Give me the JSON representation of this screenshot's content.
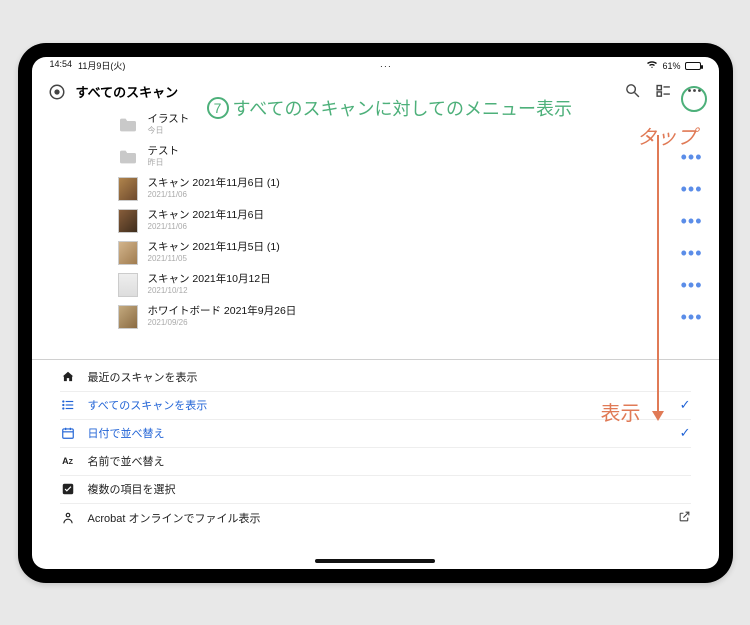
{
  "status": {
    "time": "14:54",
    "date": "11月9日(火)",
    "battery_text": "61%"
  },
  "header": {
    "title": "すべてのスキャン"
  },
  "annotations": {
    "step_number": "7",
    "step_text": "すべてのスキャンに対してのメニュー表示",
    "tap_label": "タップ",
    "show_label": "表示"
  },
  "scans": [
    {
      "type": "folder",
      "title": "イラスト",
      "sub": "今日",
      "more": false,
      "thumb": "folder"
    },
    {
      "type": "folder",
      "title": "テスト",
      "sub": "昨日",
      "more": true,
      "thumb": "folder"
    },
    {
      "type": "scan",
      "title": "スキャン 2021年11月6日 (1)",
      "sub": "2021/11/06",
      "more": true,
      "thumb": "img1"
    },
    {
      "type": "scan",
      "title": "スキャン 2021年11月6日",
      "sub": "2021/11/06",
      "more": true,
      "thumb": "img2"
    },
    {
      "type": "scan",
      "title": "スキャン 2021年11月5日 (1)",
      "sub": "2021/11/05",
      "more": true,
      "thumb": "img3"
    },
    {
      "type": "scan",
      "title": "スキャン 2021年10月12日",
      "sub": "2021/10/12",
      "more": true,
      "thumb": "img4"
    },
    {
      "type": "scan",
      "title": "ホワイトボード 2021年9月26日",
      "sub": "2021/09/26",
      "more": true,
      "thumb": "img5"
    }
  ],
  "menu": [
    {
      "icon": "home",
      "label": "最近のスキャンを表示",
      "state": ""
    },
    {
      "icon": "list",
      "label": "すべてのスキャンを表示",
      "state": "checked"
    },
    {
      "icon": "calendar",
      "label": "日付で並べ替え",
      "state": "checked"
    },
    {
      "icon": "az",
      "label": "名前で並べ替え",
      "state": ""
    },
    {
      "icon": "check",
      "label": "複数の項目を選択",
      "state": ""
    },
    {
      "icon": "acrobat",
      "label": "Acrobat オンラインでファイル表示",
      "state": "open"
    }
  ]
}
